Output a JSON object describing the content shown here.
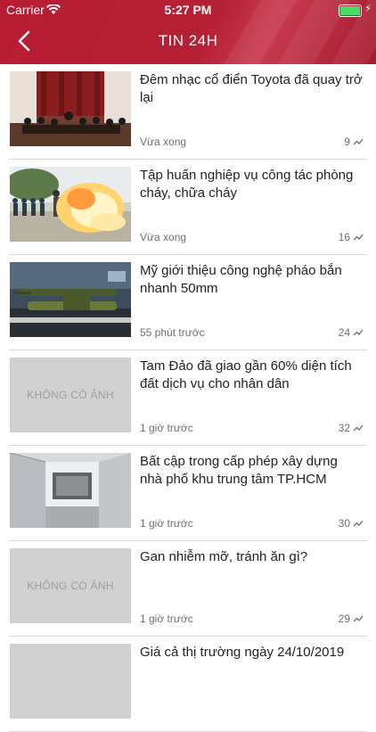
{
  "status_bar": {
    "carrier": "Carrier",
    "time": "5:27 PM"
  },
  "nav": {
    "title": "TIN 24H"
  },
  "colors": {
    "header": "#b81d33",
    "text": "#222222",
    "meta": "#6e6e6e",
    "battery": "#4cd964"
  },
  "articles": [
    {
      "title": "Đêm nhạc cổ điển Toyota đã quay trở lại",
      "time": "Vừa xong",
      "views": "9",
      "image": "orchestra-photo"
    },
    {
      "title": "Tập huấn nghiệp vụ công tác phòng cháy, chữa cháy",
      "time": "Vừa xong",
      "views": "16",
      "image": "fire-training-photo"
    },
    {
      "title": "Mỹ giới thiệu công nghệ pháo bắn nhanh 50mm",
      "time": "55 phút trước",
      "views": "24",
      "image": "cannon-photo"
    },
    {
      "title": "Tam Đảo đã giao gần 60% diện tích đất dịch vụ cho nhân dân",
      "time": "1 giờ trước",
      "views": "32",
      "image": "KHÔNG CÓ ẢNH"
    },
    {
      "title": "Bất cập trong cấp phép xây dựng nhà phố khu trung tâm TP.HCM",
      "time": "1 giờ trước",
      "views": "30",
      "image": "building-photo"
    },
    {
      "title": "Gan nhiễm mỡ, tránh ăn gì?",
      "time": "1 giờ trước",
      "views": "29",
      "image": "KHÔNG CÓ ẢNH"
    },
    {
      "title": "Giá cả thị trường ngày 24/10/2019",
      "time": "",
      "views": "",
      "image": ""
    }
  ]
}
